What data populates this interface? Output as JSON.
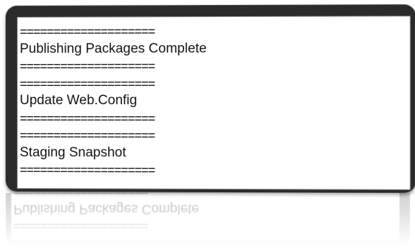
{
  "console": {
    "lines": [
      {
        "kind": "separator",
        "text": "===================="
      },
      {
        "kind": "text",
        "text": "Publishing Packages Complete"
      },
      {
        "kind": "separator",
        "text": "===================="
      },
      {
        "kind": "separator",
        "text": "===================="
      },
      {
        "kind": "text",
        "text": "Update Web.Config"
      },
      {
        "kind": "separator",
        "text": "===================="
      },
      {
        "kind": "separator",
        "text": "===================="
      },
      {
        "kind": "text",
        "text": "Staging Snapshot"
      },
      {
        "kind": "separator",
        "text": "===================="
      }
    ]
  },
  "colors": {
    "frame": "#2b2b2b",
    "panel_background": "#ffffff",
    "text": "#111111"
  }
}
